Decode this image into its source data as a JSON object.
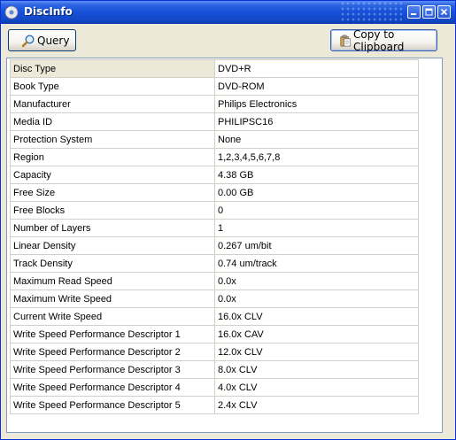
{
  "window": {
    "title": "DiscInfo"
  },
  "toolbar": {
    "query_label": "Query",
    "copy_label": "Copy to Clipboard"
  },
  "table": {
    "rows": [
      {
        "key": "Disc Type",
        "value": "DVD+R"
      },
      {
        "key": "Book Type",
        "value": "DVD-ROM"
      },
      {
        "key": "Manufacturer",
        "value": "Philips Electronics"
      },
      {
        "key": "Media ID",
        "value": "PHILIPSC16"
      },
      {
        "key": "Protection System",
        "value": "None"
      },
      {
        "key": "Region",
        "value": "1,2,3,4,5,6,7,8"
      },
      {
        "key": "Capacity",
        "value": "4.38 GB"
      },
      {
        "key": "Free Size",
        "value": "0.00 GB"
      },
      {
        "key": "Free Blocks",
        "value": "0"
      },
      {
        "key": "Number of Layers",
        "value": "1"
      },
      {
        "key": "Linear Density",
        "value": "0.267 um/bit"
      },
      {
        "key": "Track Density",
        "value": "0.74 um/track"
      },
      {
        "key": "Maximum Read Speed",
        "value": "0.0x"
      },
      {
        "key": "Maximum Write Speed",
        "value": "0.0x"
      },
      {
        "key": "Current Write Speed",
        "value": "16.0x CLV"
      },
      {
        "key": "Write Speed Performance Descriptor 1",
        "value": "16.0x CAV"
      },
      {
        "key": "Write Speed Performance Descriptor 2",
        "value": "12.0x CLV"
      },
      {
        "key": "Write Speed Performance Descriptor 3",
        "value": "8.0x CLV"
      },
      {
        "key": "Write Speed Performance Descriptor 4",
        "value": "4.0x CLV"
      },
      {
        "key": "Write Speed Performance Descriptor 5",
        "value": "2.4x CLV"
      }
    ]
  },
  "colors": {
    "titlebar": "#1550d8",
    "face": "#ece9d8",
    "grid": "#d4d0c8"
  }
}
